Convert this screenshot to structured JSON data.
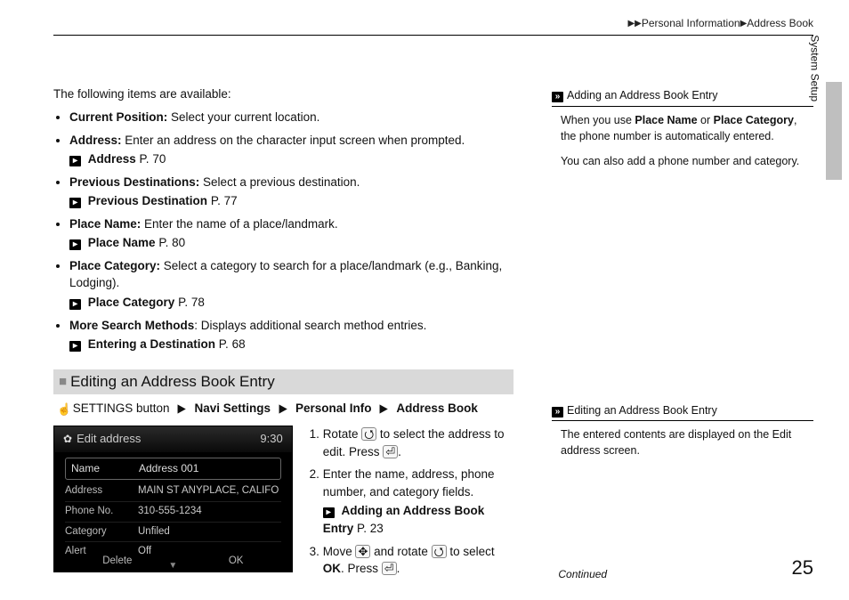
{
  "breadcrumb": {
    "a": "Personal Information",
    "b": "Address Book"
  },
  "sideTab": "System Setup",
  "intro": "The following items are available:",
  "items": [
    {
      "label": "Current Position:",
      "text": " Select your current location.",
      "xref": null
    },
    {
      "label": "Address:",
      "text": " Enter an address on the character input screen when prompted.",
      "xref": {
        "title": "Address",
        "page": "P. 70"
      }
    },
    {
      "label": "Previous Destinations:",
      "text": " Select a previous destination.",
      "xref": {
        "title": "Previous Destination",
        "page": "P. 77"
      }
    },
    {
      "label": "Place Name:",
      "text": " Enter the name of a place/landmark.",
      "xref": {
        "title": "Place Name",
        "page": "P. 80"
      }
    },
    {
      "label": "Place Category:",
      "text": " Select a category to search for a place/landmark (e.g., Banking, Lodging).",
      "xref": {
        "title": "Place Category",
        "page": "P. 78"
      }
    },
    {
      "label": "More Search Methods",
      "text": ": Displays additional search method entries.",
      "xref": {
        "title": "Entering a Destination",
        "page": "P. 68"
      }
    }
  ],
  "sectionTitle": "Editing an Address Book Entry",
  "navPath": {
    "prefix": "SETTINGS button",
    "b1": "Navi Settings",
    "b2": "Personal Info",
    "b3": "Address Book"
  },
  "device": {
    "title": "Edit address",
    "time": "9:30",
    "rows": {
      "nameLabel": "Name",
      "nameVal": "Address 001",
      "addrLabel": "Address",
      "addrVal": "MAIN ST ANYPLACE, CALIFO",
      "phoneLabel": "Phone No.",
      "phoneVal": "310-555-1234",
      "catLabel": "Category",
      "catVal": "Unfiled",
      "alertLabel": "Alert",
      "alertVal": "Off"
    },
    "footer": {
      "delete": "Delete",
      "ok": "OK"
    }
  },
  "steps": {
    "s1a": "Rotate ",
    "s1b": " to select the address to edit. Press ",
    "s1c": ".",
    "s2a": "Enter the name, address, phone number, and category fields.",
    "s2xrefTitle": "Adding an Address Book Entry",
    "s2xrefPage": "P. 23",
    "s3a": "Move ",
    "s3b": " and rotate ",
    "s3c": " to select ",
    "s3ok": "OK",
    "s3d": ". Press ",
    "s3e": "."
  },
  "notes": {
    "n1title": "Adding an Address Book Entry",
    "n1p1a": "When you use ",
    "n1p1b": "Place Name",
    "n1p1c": " or ",
    "n1p1d": "Place Category",
    "n1p1e": ", the phone number is automatically entered.",
    "n1p2": "You can also add a phone number and category.",
    "n2title": "Editing an Address Book Entry",
    "n2p1": "The entered contents are displayed on the Edit address screen."
  },
  "footer": {
    "continued": "Continued",
    "page": "25"
  }
}
